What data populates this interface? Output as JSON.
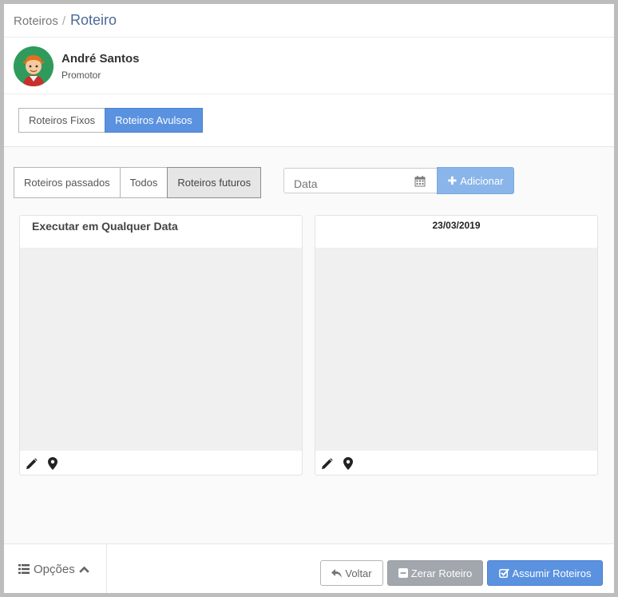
{
  "breadcrumb": {
    "root": "Roteiros",
    "separator": "/",
    "current": "Roteiro"
  },
  "user": {
    "name": "André Santos",
    "role": "Promotor"
  },
  "route_type_tabs": [
    {
      "label": "Roteiros Fixos",
      "active": false
    },
    {
      "label": "Roteiros Avulsos",
      "active": true
    }
  ],
  "period_filter": [
    {
      "label": "Roteiros passados",
      "active": false
    },
    {
      "label": "Todos",
      "active": false
    },
    {
      "label": "Roteiros futuros",
      "active": true
    }
  ],
  "date_input": {
    "placeholder": "Data",
    "icon": "calendar-icon"
  },
  "add_button": {
    "label": "Adicionar",
    "icon": "plus-icon"
  },
  "cards": [
    {
      "title": "Executar em Qualquer Data",
      "icons": [
        "pencil-icon",
        "map-pin-icon"
      ]
    },
    {
      "title": "23/03/2019",
      "icons": [
        "pencil-icon",
        "map-pin-icon"
      ]
    }
  ],
  "footer": {
    "options_label": "Opções",
    "back_label": "Voltar",
    "reset_label": "Zerar Roteiro",
    "assume_label": "Assumir Roteiros"
  },
  "colors": {
    "primary": "#5b92e0",
    "primary_light": "#8ab5ea",
    "disabled": "#a2a7ad",
    "avatar_bg": "#2e9b5c",
    "breadcrumb_current": "#4a6a96"
  }
}
